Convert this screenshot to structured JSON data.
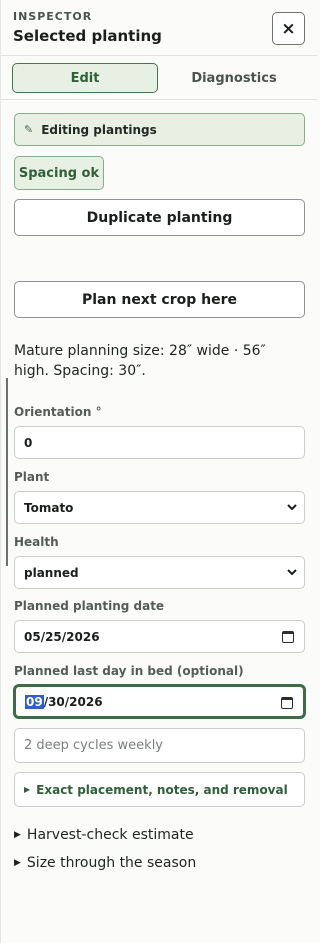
{
  "header": {
    "kicker": "INSPECTOR",
    "title": "Selected planting",
    "close_label": "×"
  },
  "tabs": [
    {
      "label": "Edit",
      "active": true
    },
    {
      "label": "Diagnostics",
      "active": false
    }
  ],
  "editing_chip": {
    "icon": "pencil-icon",
    "glyph": "✎",
    "label": "Editing plantings"
  },
  "status_chip": {
    "label": "Spacing ok"
  },
  "buttons": {
    "duplicate": "Duplicate planting",
    "plan_next": "Plan next crop here"
  },
  "size_summary": "Mature planning size: 28″ wide · 56″ high. Spacing: 30″.",
  "fields": {
    "orientation": {
      "label": "Orientation °",
      "value": "0"
    },
    "plant": {
      "label": "Plant",
      "value": "Tomato"
    },
    "health": {
      "label": "Health",
      "value": "planned"
    },
    "planting_date": {
      "label": "Planned planting date",
      "value": "05/25/2026"
    },
    "last_day": {
      "label": "Planned last day in bed (optional)",
      "value_selected": "09",
      "value_rest": "/30/2026"
    }
  },
  "notes_placeholder": "2 deep cycles weekly",
  "expander_label": "Exact placement, notes, and removal",
  "disclosures": [
    "Harvest-check estimate",
    "Size through the season"
  ],
  "colors": {
    "accent": "#3e7a4a",
    "accent_bg": "#e7f0e3",
    "selection": "#2d5fd3"
  }
}
